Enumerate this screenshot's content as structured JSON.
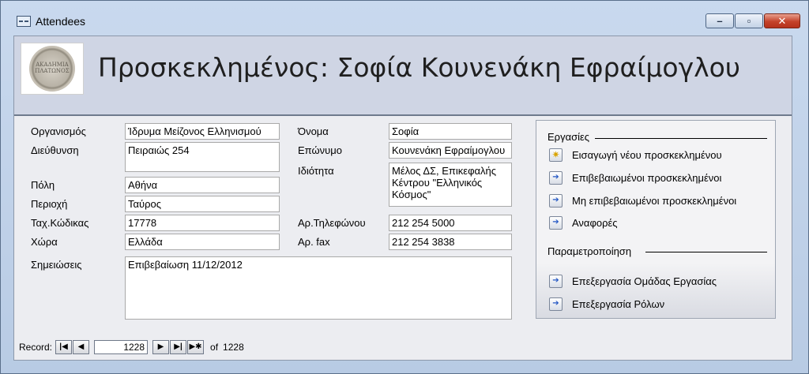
{
  "window": {
    "title": "Attendees",
    "minimize_icon": "minimize-icon",
    "restore_icon": "restore-icon",
    "close_icon": "close-icon"
  },
  "header": {
    "logo_text": "ΑΚΑΔΗΜΙΑ ΠΛΑΤΩΝΟΣ",
    "title": "Προσκεκλημένος: Σοφία Κουνενάκη Εφραίμογλου"
  },
  "form": {
    "organization": {
      "label": "Οργανισμός",
      "value": "Ίδρυμα Μείζονος Ελληνισμού"
    },
    "address": {
      "label": "Διεύθυνση",
      "value": "Πειραιώς 254"
    },
    "city": {
      "label": "Πόλη",
      "value": "Αθήνα"
    },
    "region": {
      "label": "Περιοχή",
      "value": "Ταύρος"
    },
    "postal_code": {
      "label": "Ταχ.Κώδικας",
      "value": "17778"
    },
    "country": {
      "label": "Χώρα",
      "value": "Ελλάδα"
    },
    "notes": {
      "label": "Σημειώσεις",
      "value": "Επιβεβαίωση 11/12/2012"
    },
    "first_name": {
      "label": "Όνομα",
      "value": "Σοφία"
    },
    "last_name": {
      "label": "Επώνυμο",
      "value": "Κουνενάκη Εφραίμογλου"
    },
    "role": {
      "label": "Ιδιότητα",
      "value": "Μέλος ΔΣ, Επικεφαλής Κέντρου \"Ελληνικός Κόσμος\""
    },
    "phone": {
      "label": "Αρ.Τηλεφώνου",
      "value": "212 254 5000"
    },
    "fax": {
      "label": "Αρ. fax",
      "value": "212 254 3838"
    }
  },
  "tasks": {
    "heading": "Εργασίες",
    "items": [
      {
        "label": "Εισαγωγή νέου προσκεκλημένου",
        "icon": "new-record-icon"
      },
      {
        "label": "Επιβεβαιωμένοι προσκεκλημένοι",
        "icon": "arrow-right-icon"
      },
      {
        "label": "Μη επιβεβαιωμένοι προσκεκλημένοι",
        "icon": "arrow-right-icon"
      },
      {
        "label": "Αναφορές",
        "icon": "arrow-right-icon"
      }
    ],
    "settings_heading": "Παραμετροποίηση",
    "settings_items": [
      {
        "label": "Επεξεργασία Ομάδας Εργασίας",
        "icon": "arrow-right-icon"
      },
      {
        "label": "Επεξεργασία Ρόλων",
        "icon": "arrow-right-icon"
      }
    ]
  },
  "navigator": {
    "label": "Record:",
    "current": "1228",
    "of_label": "of",
    "total": "1228",
    "first_icon": "first-record-icon",
    "prev_icon": "previous-record-icon",
    "next_icon": "next-record-icon",
    "last_icon": "last-record-icon",
    "new_icon": "new-record-icon"
  }
}
